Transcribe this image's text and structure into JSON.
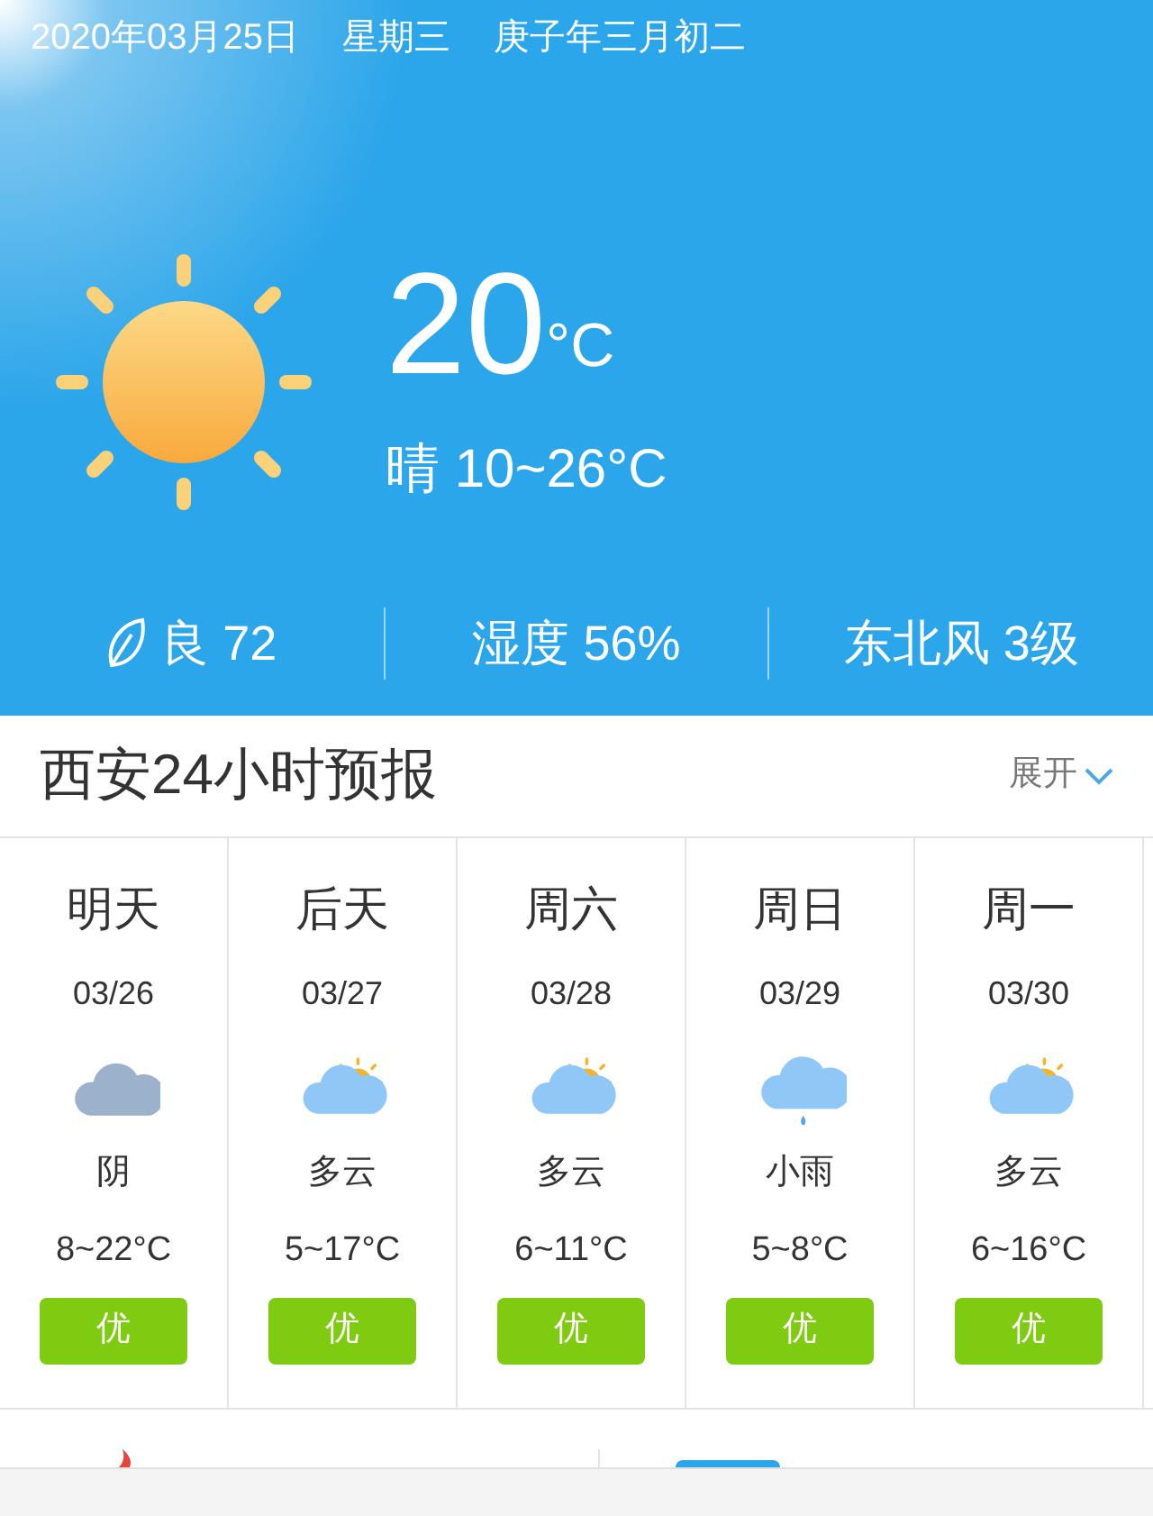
{
  "header": {
    "date": "2020年03月25日",
    "weekday": "星期三",
    "lunar": "庚子年三月初二",
    "temperature": "20",
    "unit": "°C",
    "summary": "晴 10~26°C",
    "stats": [
      {
        "kind": "air",
        "text": "良 72"
      },
      {
        "kind": "plain",
        "text": "湿度 56%"
      },
      {
        "kind": "plain",
        "text": "东北风 3级"
      }
    ]
  },
  "forecast": {
    "title": "西安24小时预报",
    "expand": "展开",
    "days": [
      {
        "day": "明天",
        "date": "03/26",
        "kind": "overcast",
        "weather": "阴",
        "range": "8~22°C",
        "air": "优"
      },
      {
        "day": "后天",
        "date": "03/27",
        "kind": "partly_cloudy",
        "weather": "多云",
        "range": "5~17°C",
        "air": "优"
      },
      {
        "day": "周六",
        "date": "03/28",
        "kind": "partly_cloudy",
        "weather": "多云",
        "range": "6~11°C",
        "air": "优"
      },
      {
        "day": "周日",
        "date": "03/29",
        "kind": "rain",
        "weather": "小雨",
        "range": "5~8°C",
        "air": "优"
      },
      {
        "day": "周一",
        "date": "03/30",
        "kind": "partly_cloudy",
        "weather": "多云",
        "range": "6~16°C",
        "air": "优"
      }
    ]
  }
}
